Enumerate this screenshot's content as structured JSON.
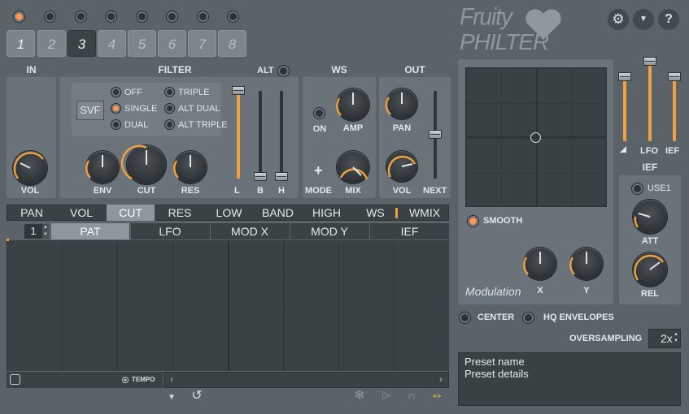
{
  "slots": [
    "1",
    "2",
    "3",
    "4",
    "5",
    "6",
    "7",
    "8"
  ],
  "selected_slot": "3",
  "in": {
    "title": "IN",
    "vol": "VOL"
  },
  "filter": {
    "title": "FILTER",
    "alt": "ALT",
    "type": "SVF",
    "modes": [
      "OFF",
      "SINGLE",
      "DUAL",
      "TRIPLE",
      "ALT DUAL",
      "ALT TRIPLE"
    ],
    "active_mode": "SINGLE",
    "knobs": [
      "ENV",
      "CUT",
      "RES"
    ],
    "faders": [
      "L",
      "B",
      "H"
    ]
  },
  "ws": {
    "title": "WS",
    "on": "ON",
    "amp": "AMP",
    "mode": "MODE",
    "mix": "MIX",
    "mode_symbol": "+"
  },
  "out": {
    "title": "OUT",
    "pan": "PAN",
    "vol": "VOL",
    "next": "NEXT"
  },
  "param_tabs": [
    "PAN",
    "VOL",
    "CUT",
    "RES",
    "LOW",
    "BAND",
    "HIGH",
    "WS",
    "WMIX"
  ],
  "active_param_tab": "CUT",
  "pattern": {
    "number": "1",
    "tabs": [
      "PAT",
      "LFO",
      "MOD X",
      "MOD Y",
      "IEF"
    ],
    "active_tab": "PAT",
    "tempo": "TEMPO"
  },
  "brand": {
    "line1": "Fruity",
    "line2": "PHILTER"
  },
  "header_buttons": [
    "gear-icon",
    "chevron-down-icon",
    "help-icon"
  ],
  "help_label": "?",
  "right_faders": {
    "lfo": "LFO",
    "ief": "IEF"
  },
  "modulation": {
    "smooth": "SMOOTH",
    "title": "Modulation",
    "x": "X",
    "y": "Y"
  },
  "ief": {
    "title": "IEF",
    "use1": "USE1",
    "att": "ATT",
    "rel": "REL"
  },
  "options": {
    "center": "CENTER",
    "hq": "HQ ENVELOPES",
    "oversampling_label": "OVERSAMPLING",
    "oversampling_value": "2x"
  },
  "preset": {
    "name": "Preset name",
    "details": "Preset details"
  },
  "colors": {
    "accent": "#f0a040",
    "panel": "#6a7379",
    "dark": "#3b4246"
  }
}
